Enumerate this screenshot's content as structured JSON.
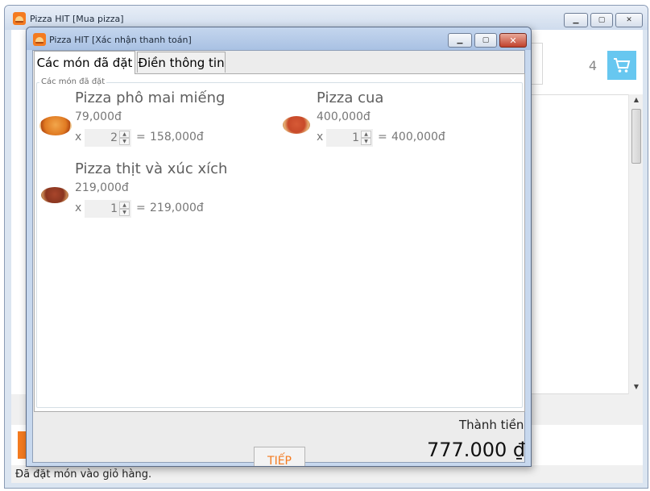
{
  "main_window": {
    "title": "Pizza HIT [Mua pizza]",
    "cart_count": "4",
    "status": "Đã đặt món vào giỏ hàng."
  },
  "dialog": {
    "title": "Pizza HIT [Xác nhận thanh toán]",
    "tabs": [
      {
        "label": "Các món đã đặt",
        "active": true
      },
      {
        "label": "Điền thông tin",
        "active": false
      }
    ],
    "group_label": "Các món đã đặt",
    "items": [
      {
        "name": "Pizza phô mai miếng",
        "price": "79,000đ",
        "x": "x",
        "qty": "2",
        "eq": "=",
        "total": "158,000đ",
        "image": "cheese-pizza"
      },
      {
        "name": "Pizza cua",
        "price": "400,000đ",
        "x": "x",
        "qty": "1",
        "eq": "=",
        "total": "400,000đ",
        "image": "crab-pizza"
      },
      {
        "name": "Pizza thịt và xúc xích",
        "price": "219,000đ",
        "x": "x",
        "qty": "1",
        "eq": "=",
        "total": "219,000đ",
        "image": "meat-pizza"
      }
    ],
    "total_label": "Thành tiền",
    "total_value": "777.000 ₫",
    "next_button": "TIẾP"
  },
  "icons": {
    "app": "pizza-app-icon",
    "cart": "shopping-cart-icon",
    "minimize": "minimize-icon",
    "maximize": "maximize-icon",
    "close": "close-icon"
  },
  "colors": {
    "accent": "#f47b20",
    "cart_button": "#67c7f0",
    "close_button": "#c0412c"
  }
}
